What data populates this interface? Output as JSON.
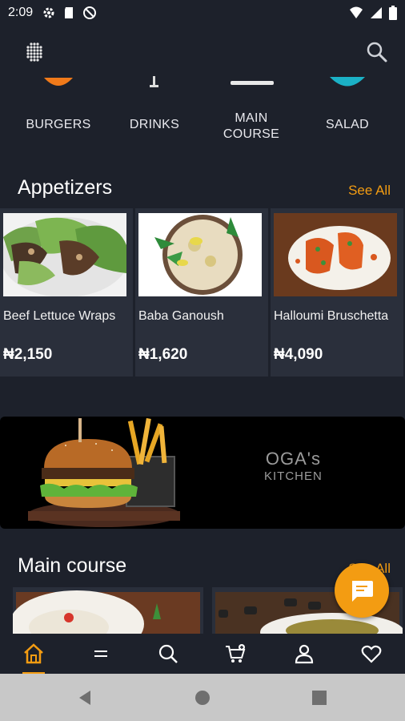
{
  "status": {
    "time": "2:09"
  },
  "categories": [
    {
      "label_line1": "BURGERS",
      "label_line2": ""
    },
    {
      "label_line1": "DRINKS",
      "label_line2": ""
    },
    {
      "label_line1": "MAIN",
      "label_line2": "COURSE"
    },
    {
      "label_line1": "SALAD",
      "label_line2": ""
    }
  ],
  "appetizers": {
    "title": "Appetizers",
    "see_all": "See All",
    "items": [
      {
        "name": "Beef Lettuce Wraps",
        "price": "₦2,150"
      },
      {
        "name": "Baba Ganoush",
        "price": "₦1,620"
      },
      {
        "name": "Halloumi Bruschetta",
        "price": "₦4,090"
      }
    ]
  },
  "banner": {
    "brand_line1": "OGA's",
    "brand_line2": "KITCHEN"
  },
  "main_course": {
    "title": "Main course",
    "see_all": "See All"
  },
  "colors": {
    "accent": "#f39c12",
    "background": "#1d212b",
    "card": "#2a2f3b"
  },
  "bottom_nav": [
    "home-icon",
    "menu-icon",
    "search-icon",
    "cart-icon",
    "profile-icon",
    "heart-icon"
  ]
}
